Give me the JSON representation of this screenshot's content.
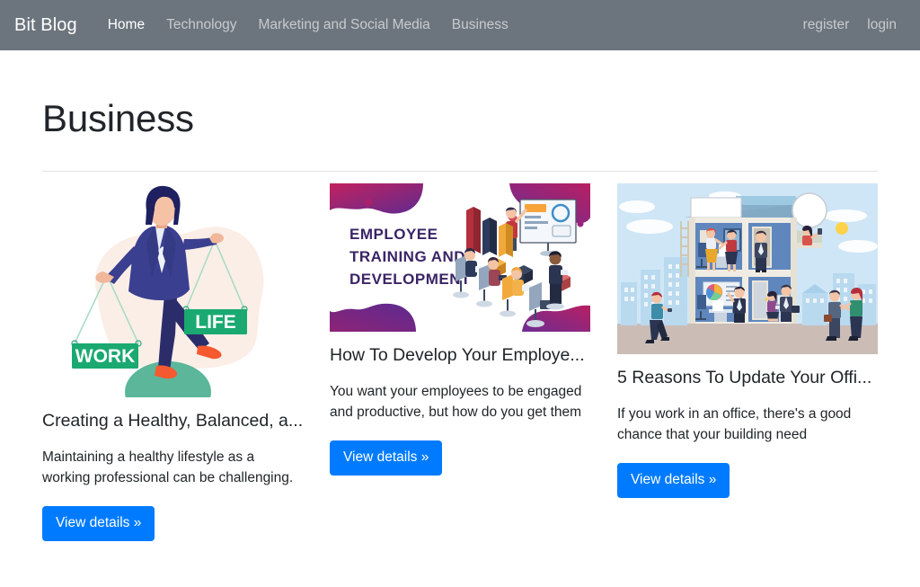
{
  "navbar": {
    "brand": "Bit Blog",
    "links": [
      {
        "label": "Home",
        "active": true
      },
      {
        "label": "Technology",
        "active": false
      },
      {
        "label": "Marketing and Social Media",
        "active": false
      },
      {
        "label": "Business",
        "active": false
      }
    ],
    "right_links": [
      {
        "label": "register"
      },
      {
        "label": "login"
      }
    ],
    "background_color": "#6c757d",
    "brand_color": "#ffffff",
    "link_color": "rgba(255,255,255,0.62)"
  },
  "page": {
    "title": "Business",
    "title_color": "#212529",
    "background_color": "#ffffff",
    "divider_color": "#e3e3e3"
  },
  "cards": [
    {
      "image_name": "work-life-balance-illustration",
      "image_alt": "Businesswoman balancing WORK and LIFE signs",
      "image_labels": {
        "left_sign": "WORK",
        "right_sign": "LIFE"
      },
      "title": "Creating a Healthy, Balanced, a...",
      "text": "Maintaining a healthy lifestyle as a working professional can be challenging.",
      "button_label": "View details »"
    },
    {
      "image_name": "employee-training-illustration",
      "image_alt": "Employee training and development banner with people at a presentation",
      "image_labels": {
        "heading_line1": "EMPLOYEE",
        "heading_line2": "TRAINING AND",
        "heading_line3": "DEVELOPMENT"
      },
      "title": "How To Develop Your Employe...",
      "text": "You want your employees to be engaged and productive, but how do you get them",
      "button_label": "View details »"
    },
    {
      "image_name": "office-building-illustration",
      "image_alt": "Cutaway view of a two storey office building with workers",
      "image_labels": {},
      "title": "5 Reasons To Update Your Offi...",
      "text": "If you work in an office, there's a good chance that your building need",
      "button_label": "View details »"
    }
  ],
  "theme": {
    "primary_button_color": "#007bff",
    "button_text_color": "#ffffff",
    "body_text_color": "#212529"
  }
}
